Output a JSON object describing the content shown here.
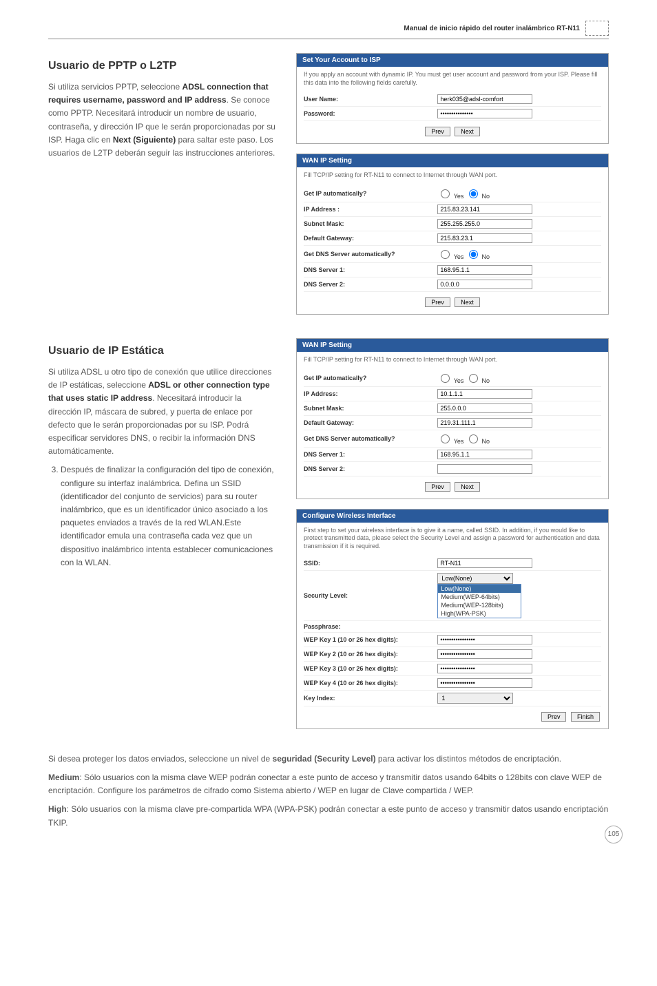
{
  "header": {
    "title": "Manual de inicio rápido del router inalámbrico RT-N11",
    "logo_alt": "logo-icon"
  },
  "section1": {
    "heading": "Usuario de PPTP o L2TP",
    "body_parts": [
      "Si utiliza servicios PPTP, seleccione ",
      "ADSL connection that requires username, password and IP address",
      ". Se conoce como PPTP. Necesitará introducir un nombre de usuario, contraseña, y dirección IP que le serán proporcionadas por su ISP. Haga clic en ",
      "Next (Siguiente)",
      " para saltar este paso. Los usuarios de L2TP deberán seguir las instrucciones anteriores."
    ]
  },
  "panel1": {
    "title": "Set Your Account to ISP",
    "desc": "If you apply an account with dynamic IP. You must get user account and password from your ISP. Please fill this data into the following fields carefully.",
    "rows": {
      "user_label": "User Name:",
      "user_value": "herk035@adsl-comfort",
      "pass_label": "Password:",
      "pass_value": "***************"
    },
    "prev": "Prev",
    "next": "Next"
  },
  "panel2": {
    "title": "WAN IP Setting",
    "desc": "Fill TCP/IP setting for RT-N11 to connect to Internet through WAN port.",
    "rows": {
      "auto_label": "Get IP automatically?",
      "auto_yes": "Yes",
      "auto_no": "No",
      "ip_label": "IP Address  :",
      "ip_value": "215.83.23.141",
      "mask_label": "Subnet Mask:",
      "mask_value": "255.255.255.0",
      "gw_label": "Default Gateway:",
      "gw_value": "215.83.23.1",
      "dnsauto_label": "Get DNS Server automatically?",
      "dnsauto_yes": "Yes",
      "dnsauto_no": "No",
      "dns1_label": "DNS Server 1:",
      "dns1_value": "168.95.1.1",
      "dns2_label": "DNS Server 2:",
      "dns2_value": "0.0.0.0"
    },
    "prev": "Prev",
    "next": "Next"
  },
  "section2": {
    "heading": "Usuario de IP Estática",
    "body_parts": [
      "Si utiliza ADSL u otro tipo de conexión que utilice direcciones de IP estáticas, seleccione ",
      "ADSL or other connection type that uses static IP address",
      ". Necesitará introducir la dirección IP, máscara de subred, y puerta de enlace por defecto que le serán proporcionadas por su ISP. Podrá especificar servidores DNS, o recibir la información DNS automáticamente."
    ],
    "step3": "Después de finalizar la configuración del tipo de conexión, configure su interfaz inalámbrica. Defina un SSID (identificador del conjunto de servicios) para su router inalámbrico, que es un identificador único asociado a los paquetes enviados a través de la red WLAN.Este identificador emula una contraseña cada vez que un dispositivo inalámbrico intenta establecer comunicaciones con la WLAN."
  },
  "panel3": {
    "title": "WAN IP Setting",
    "desc": "Fill TCP/IP setting for RT-N11 to connect to Internet through WAN port.",
    "rows": {
      "auto_label": "Get IP automatically?",
      "auto_yes": "Yes",
      "auto_no": "No",
      "ip_label": "IP Address:",
      "ip_value": "10.1.1.1",
      "mask_label": "Subnet Mask:",
      "mask_value": "255.0.0.0",
      "gw_label": "Default Gateway:",
      "gw_value": "219.31.111.1",
      "dnsauto_label": "Get DNS Server automatically?",
      "dnsauto_yes": "Yes",
      "dnsauto_no": "No",
      "dns1_label": "DNS Server 1:",
      "dns1_value": "168.95.1.1",
      "dns2_label": "DNS Server 2:",
      "dns2_value": ""
    },
    "prev": "Prev",
    "next": "Next"
  },
  "panel4": {
    "title": "Configure Wireless Interface",
    "desc": "First step to set your wireless interface is to give it a name, called SSID. In addition, if you would like to protect transmitted data, please select the Security Level and assign a password for authentication and data transmission if it is required.",
    "rows": {
      "ssid_label": "SSID:",
      "ssid_value": "RT-N11",
      "sec_label": "Security Level:",
      "sec_value": "Low(None)",
      "pass_label": "Passphrase:",
      "wep1_label": "WEP Key 1 (10 or 26 hex digits):",
      "wep2_label": "WEP Key 2 (10 or 26 hex digits):",
      "wep3_label": "WEP Key 3 (10 or 26 hex digits):",
      "wep4_label": "WEP Key 4 (10 or 26 hex digits):",
      "keyidx_label": "Key Index:",
      "keyidx_value": "1"
    },
    "dropdown": {
      "opt1": "Low(None)",
      "opt2": "Medium(WEP-64bits)",
      "opt3": "Medium(WEP-128bits)",
      "opt4": "High(WPA-PSK)"
    },
    "prev": "Prev",
    "finish": "Finish"
  },
  "bottom": {
    "p1a": "Si desea proteger los datos enviados, seleccione un nivel de ",
    "p1b": "seguridad (Security Level)",
    "p1c": " para activar los distintos métodos de encriptación.",
    "p2a": "Medium",
    "p2b": ": Sólo usuarios con la misma clave WEP podrán conectar a este punto de acceso y transmitir datos usando 64bits o 128bits con clave WEP de encriptación. Configure los parámetros de cifrado como Sistema abierto / WEP en lugar de Clave compartida / WEP.",
    "p3a": "High",
    "p3b": ": Sólo usuarios con la misma clave pre-compartida WPA (WPA-PSK) podrán conectar a este punto de acceso y transmitir datos usando encriptación TKIP."
  },
  "page_number": "105"
}
